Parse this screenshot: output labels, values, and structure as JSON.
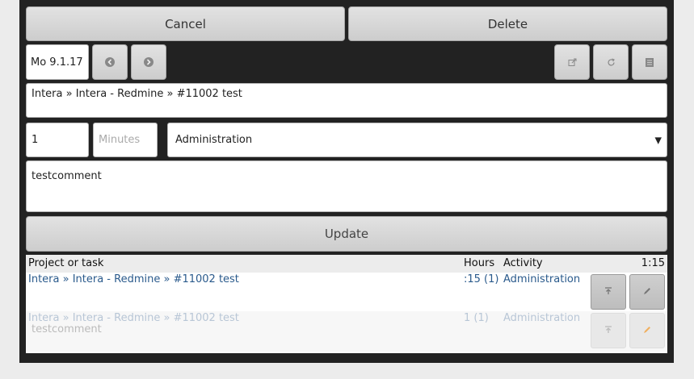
{
  "actions": {
    "cancel_label": "Cancel",
    "delete_label": "Delete"
  },
  "date_nav": {
    "date": "Mo 9.1.17",
    "prev_icon": "circle-arrow-left-icon",
    "next_icon": "circle-arrow-right-icon"
  },
  "toolbar": {
    "icons": [
      "external-link-icon",
      "refresh-icon",
      "list-icon"
    ]
  },
  "form": {
    "task_value": "Intera » Intera - Redmine » #11002 test",
    "hours_value": "1",
    "minutes_placeholder": "Minutes",
    "activity_selected": "Administration",
    "comment_value": "testcomment",
    "update_label": "Update"
  },
  "table": {
    "headers": {
      "project": "Project or task",
      "hours": "Hours",
      "activity": "Activity",
      "total": "1:15"
    },
    "rows": [
      {
        "task": "Intera » Intera - Redmine » #11002 test",
        "hours": ":15 (1)",
        "activity": "Administration",
        "comment": ""
      },
      {
        "task": "Intera » Intera - Redmine » #11002 test",
        "hours": "1 (1)",
        "activity": "Administration",
        "comment": "testcomment"
      }
    ]
  }
}
